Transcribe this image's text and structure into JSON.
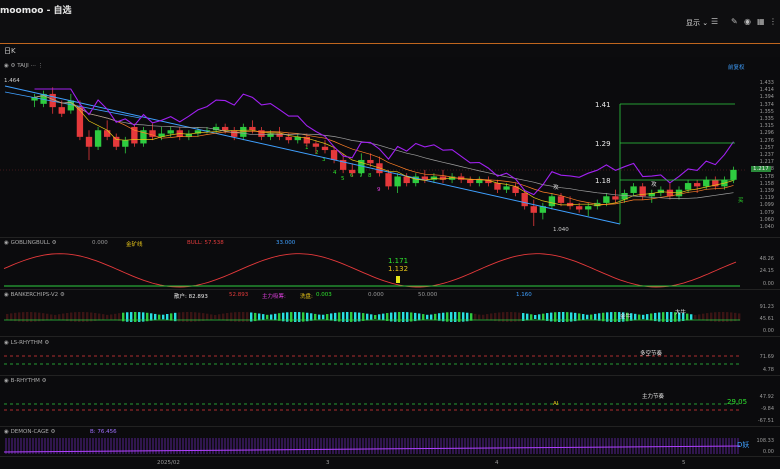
{
  "window": {
    "title": "moomoo - 自选"
  },
  "toolbar": {
    "display_label": "显示",
    "icons": [
      "menu-icon",
      "pencil-icon",
      "camera-icon",
      "layout-icon",
      "more-icon"
    ]
  },
  "period": {
    "label": "日K"
  },
  "main": {
    "indicator_label": "TAIJI",
    "restore_label": "前复权",
    "high_label": "1.464",
    "low_label": "1.040",
    "target_labels": [
      "1.41",
      "1.29",
      "1.18"
    ],
    "wave_numbers": [
      "1",
      "2",
      "3",
      "4",
      "5",
      "6",
      "7",
      "8",
      "9"
    ],
    "annotations": {
      "gong_1": "攻",
      "gong_2": "攻",
      "buy": "买"
    },
    "price_axis": [
      "1.433",
      "1.414",
      "1.394",
      "1.374",
      "1.355",
      "1.335",
      "1.315",
      "1.296",
      "1.276",
      "1.257",
      "1.237",
      "1.217",
      "1.198",
      "1.178",
      "1.158",
      "1.139",
      "1.119",
      "1.099",
      "1.079",
      "1.060",
      "1.040"
    ],
    "current_price": "1.217"
  },
  "goblin": {
    "name": "GOBLINGBULL",
    "params": [
      {
        "text": "0.000",
        "color": "#9a9a9a"
      },
      {
        "text": "金矿线",
        "color": "#e6c419"
      },
      {
        "text": "BULL: 57.538",
        "color": "#e23b3b"
      },
      {
        "text": "33.000",
        "color": "#3fa0ff"
      }
    ],
    "value_labels": [
      "1.171",
      "1.132"
    ],
    "axis": [
      "48.26",
      "24.15",
      "0.00"
    ]
  },
  "banker": {
    "name": "BANKERCHIPS-V2",
    "params": [
      {
        "text": "散户: 82.893",
        "color": "#e8e8e8"
      },
      {
        "text": "52.893",
        "color": "#e23b3b"
      },
      {
        "text": "主力吸筹:",
        "color": "#e040e0"
      },
      {
        "text": "洗盘:",
        "color": "#e6c419"
      },
      {
        "text": "0.003",
        "color": "#2ee32e"
      },
      {
        "text": "0.000",
        "color": "#9a9a9a"
      },
      {
        "text": "50.000",
        "color": "#9a9a9a"
      },
      {
        "text": "1.160",
        "color": "#3fa0ff"
      }
    ],
    "tags": [
      "金牛",
      "大牛"
    ],
    "axis": [
      "91.23",
      "45.61",
      "0.00"
    ]
  },
  "ls_rhythm": {
    "name": "LS-RHYTHM",
    "label": "多空节奏",
    "axis": [
      "71.69",
      "4.78"
    ]
  },
  "b_rhythm": {
    "name": "B-RHYTHM",
    "label": "主力节奏",
    "ai_label": "AI",
    "value_label": "29.05",
    "axis": [
      "47.92",
      "-9.84",
      "-67.51"
    ]
  },
  "demon": {
    "name": "DEMON-CAGE",
    "param": "B: 76.456",
    "tag": "D妖",
    "axis": [
      "108.33",
      "0.00"
    ]
  },
  "dates": [
    "2025/02",
    "3",
    "4",
    "5"
  ],
  "chart_data": {
    "type": "candlestick",
    "title": "",
    "ylim": [
      1.04,
      1.464
    ],
    "candles": [
      {
        "o": 1.42,
        "h": 1.44,
        "l": 1.4,
        "c": 1.43
      },
      {
        "o": 1.41,
        "h": 1.45,
        "l": 1.4,
        "c": 1.44
      },
      {
        "o": 1.44,
        "h": 1.46,
        "l": 1.38,
        "c": 1.4
      },
      {
        "o": 1.4,
        "h": 1.42,
        "l": 1.37,
        "c": 1.38
      },
      {
        "o": 1.39,
        "h": 1.44,
        "l": 1.38,
        "c": 1.42
      },
      {
        "o": 1.4,
        "h": 1.42,
        "l": 1.3,
        "c": 1.31
      },
      {
        "o": 1.31,
        "h": 1.33,
        "l": 1.24,
        "c": 1.28
      },
      {
        "o": 1.28,
        "h": 1.34,
        "l": 1.27,
        "c": 1.33
      },
      {
        "o": 1.33,
        "h": 1.36,
        "l": 1.3,
        "c": 1.31
      },
      {
        "o": 1.31,
        "h": 1.32,
        "l": 1.27,
        "c": 1.28
      },
      {
        "o": 1.28,
        "h": 1.31,
        "l": 1.26,
        "c": 1.3
      },
      {
        "o": 1.34,
        "h": 1.35,
        "l": 1.28,
        "c": 1.29
      },
      {
        "o": 1.29,
        "h": 1.34,
        "l": 1.28,
        "c": 1.33
      },
      {
        "o": 1.33,
        "h": 1.35,
        "l": 1.3,
        "c": 1.31
      },
      {
        "o": 1.31,
        "h": 1.34,
        "l": 1.3,
        "c": 1.32
      },
      {
        "o": 1.32,
        "h": 1.34,
        "l": 1.31,
        "c": 1.33
      },
      {
        "o": 1.33,
        "h": 1.34,
        "l": 1.3,
        "c": 1.31
      },
      {
        "o": 1.31,
        "h": 1.33,
        "l": 1.3,
        "c": 1.32
      },
      {
        "o": 1.32,
        "h": 1.34,
        "l": 1.31,
        "c": 1.33
      },
      {
        "o": 1.33,
        "h": 1.34,
        "l": 1.32,
        "c": 1.33
      },
      {
        "o": 1.33,
        "h": 1.35,
        "l": 1.32,
        "c": 1.34
      },
      {
        "o": 1.34,
        "h": 1.35,
        "l": 1.32,
        "c": 1.33
      },
      {
        "o": 1.33,
        "h": 1.34,
        "l": 1.3,
        "c": 1.31
      },
      {
        "o": 1.31,
        "h": 1.35,
        "l": 1.3,
        "c": 1.34
      },
      {
        "o": 1.34,
        "h": 1.36,
        "l": 1.32,
        "c": 1.33
      },
      {
        "o": 1.33,
        "h": 1.34,
        "l": 1.3,
        "c": 1.31
      },
      {
        "o": 1.31,
        "h": 1.33,
        "l": 1.3,
        "c": 1.32
      },
      {
        "o": 1.32,
        "h": 1.34,
        "l": 1.3,
        "c": 1.31
      },
      {
        "o": 1.31,
        "h": 1.32,
        "l": 1.29,
        "c": 1.3
      },
      {
        "o": 1.3,
        "h": 1.32,
        "l": 1.29,
        "c": 1.31
      },
      {
        "o": 1.31,
        "h": 1.32,
        "l": 1.28,
        "c": 1.29
      },
      {
        "o": 1.29,
        "h": 1.3,
        "l": 1.26,
        "c": 1.28
      },
      {
        "o": 1.28,
        "h": 1.3,
        "l": 1.26,
        "c": 1.27
      },
      {
        "o": 1.27,
        "h": 1.28,
        "l": 1.23,
        "c": 1.24
      },
      {
        "o": 1.24,
        "h": 1.26,
        "l": 1.2,
        "c": 1.21
      },
      {
        "o": 1.21,
        "h": 1.23,
        "l": 1.19,
        "c": 1.2
      },
      {
        "o": 1.2,
        "h": 1.26,
        "l": 1.19,
        "c": 1.24
      },
      {
        "o": 1.24,
        "h": 1.26,
        "l": 1.22,
        "c": 1.23
      },
      {
        "o": 1.23,
        "h": 1.25,
        "l": 1.19,
        "c": 1.2
      },
      {
        "o": 1.2,
        "h": 1.21,
        "l": 1.15,
        "c": 1.16
      },
      {
        "o": 1.16,
        "h": 1.2,
        "l": 1.14,
        "c": 1.19
      },
      {
        "o": 1.19,
        "h": 1.2,
        "l": 1.16,
        "c": 1.17
      },
      {
        "o": 1.17,
        "h": 1.2,
        "l": 1.16,
        "c": 1.19
      },
      {
        "o": 1.19,
        "h": 1.21,
        "l": 1.17,
        "c": 1.18
      },
      {
        "o": 1.18,
        "h": 1.2,
        "l": 1.17,
        "c": 1.19
      },
      {
        "o": 1.19,
        "h": 1.21,
        "l": 1.17,
        "c": 1.18
      },
      {
        "o": 1.18,
        "h": 1.2,
        "l": 1.17,
        "c": 1.19
      },
      {
        "o": 1.19,
        "h": 1.2,
        "l": 1.17,
        "c": 1.18
      },
      {
        "o": 1.18,
        "h": 1.19,
        "l": 1.16,
        "c": 1.17
      },
      {
        "o": 1.17,
        "h": 1.19,
        "l": 1.16,
        "c": 1.18
      },
      {
        "o": 1.18,
        "h": 1.19,
        "l": 1.16,
        "c": 1.17
      },
      {
        "o": 1.17,
        "h": 1.18,
        "l": 1.14,
        "c": 1.15
      },
      {
        "o": 1.15,
        "h": 1.17,
        "l": 1.14,
        "c": 1.16
      },
      {
        "o": 1.16,
        "h": 1.17,
        "l": 1.13,
        "c": 1.14
      },
      {
        "o": 1.14,
        "h": 1.15,
        "l": 1.09,
        "c": 1.1
      },
      {
        "o": 1.1,
        "h": 1.12,
        "l": 1.04,
        "c": 1.08
      },
      {
        "o": 1.08,
        "h": 1.11,
        "l": 1.06,
        "c": 1.1
      },
      {
        "o": 1.1,
        "h": 1.14,
        "l": 1.09,
        "c": 1.13
      },
      {
        "o": 1.13,
        "h": 1.14,
        "l": 1.1,
        "c": 1.11
      },
      {
        "o": 1.11,
        "h": 1.13,
        "l": 1.09,
        "c": 1.1
      },
      {
        "o": 1.1,
        "h": 1.11,
        "l": 1.08,
        "c": 1.09
      },
      {
        "o": 1.09,
        "h": 1.11,
        "l": 1.07,
        "c": 1.1
      },
      {
        "o": 1.1,
        "h": 1.12,
        "l": 1.09,
        "c": 1.11
      },
      {
        "o": 1.11,
        "h": 1.14,
        "l": 1.1,
        "c": 1.13
      },
      {
        "o": 1.13,
        "h": 1.15,
        "l": 1.11,
        "c": 1.12
      },
      {
        "o": 1.12,
        "h": 1.15,
        "l": 1.11,
        "c": 1.14
      },
      {
        "o": 1.14,
        "h": 1.17,
        "l": 1.13,
        "c": 1.16
      },
      {
        "o": 1.16,
        "h": 1.17,
        "l": 1.12,
        "c": 1.13
      },
      {
        "o": 1.13,
        "h": 1.15,
        "l": 1.11,
        "c": 1.14
      },
      {
        "o": 1.14,
        "h": 1.16,
        "l": 1.13,
        "c": 1.15
      },
      {
        "o": 1.15,
        "h": 1.17,
        "l": 1.12,
        "c": 1.13
      },
      {
        "o": 1.13,
        "h": 1.16,
        "l": 1.12,
        "c": 1.15
      },
      {
        "o": 1.15,
        "h": 1.18,
        "l": 1.14,
        "c": 1.17
      },
      {
        "o": 1.17,
        "h": 1.18,
        "l": 1.14,
        "c": 1.16
      },
      {
        "o": 1.16,
        "h": 1.19,
        "l": 1.15,
        "c": 1.18
      },
      {
        "o": 1.18,
        "h": 1.19,
        "l": 1.15,
        "c": 1.16
      },
      {
        "o": 1.16,
        "h": 1.19,
        "l": 1.15,
        "c": 1.18
      },
      {
        "o": 1.18,
        "h": 1.22,
        "l": 1.17,
        "c": 1.21
      }
    ]
  }
}
